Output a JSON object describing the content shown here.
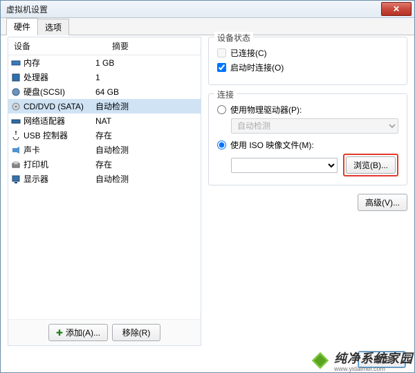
{
  "window": {
    "title": "虚拟机设置",
    "close": "✕"
  },
  "tabs": {
    "hardware": "硬件",
    "options": "选项"
  },
  "list": {
    "header_device": "设备",
    "header_summary": "摘要",
    "rows": [
      {
        "device": "内存",
        "summary": "1 GB"
      },
      {
        "device": "处理器",
        "summary": "1"
      },
      {
        "device": "硬盘(SCSI)",
        "summary": "64 GB"
      },
      {
        "device": "CD/DVD (SATA)",
        "summary": "自动检测"
      },
      {
        "device": "网络适配器",
        "summary": "NAT"
      },
      {
        "device": "USB 控制器",
        "summary": "存在"
      },
      {
        "device": "声卡",
        "summary": "自动检测"
      },
      {
        "device": "打印机",
        "summary": "存在"
      },
      {
        "device": "显示器",
        "summary": "自动检测"
      }
    ]
  },
  "left_buttons": {
    "add": "添加(A)...",
    "remove": "移除(R)"
  },
  "status_group": {
    "title": "设备状态",
    "connected": "已连接(C)",
    "connect_on_poweron": "启动时连接(O)"
  },
  "connection_group": {
    "title": "连接",
    "use_physical": "使用物理驱动器(P):",
    "physical_value": "自动检测",
    "use_iso": "使用 ISO 映像文件(M):",
    "iso_value": "",
    "browse": "浏览(B)..."
  },
  "advanced": "高级(V)...",
  "footer": {
    "ok": "确定"
  },
  "watermark": {
    "cn": "纯净系统家园",
    "en": "www.yidaimei.com"
  }
}
